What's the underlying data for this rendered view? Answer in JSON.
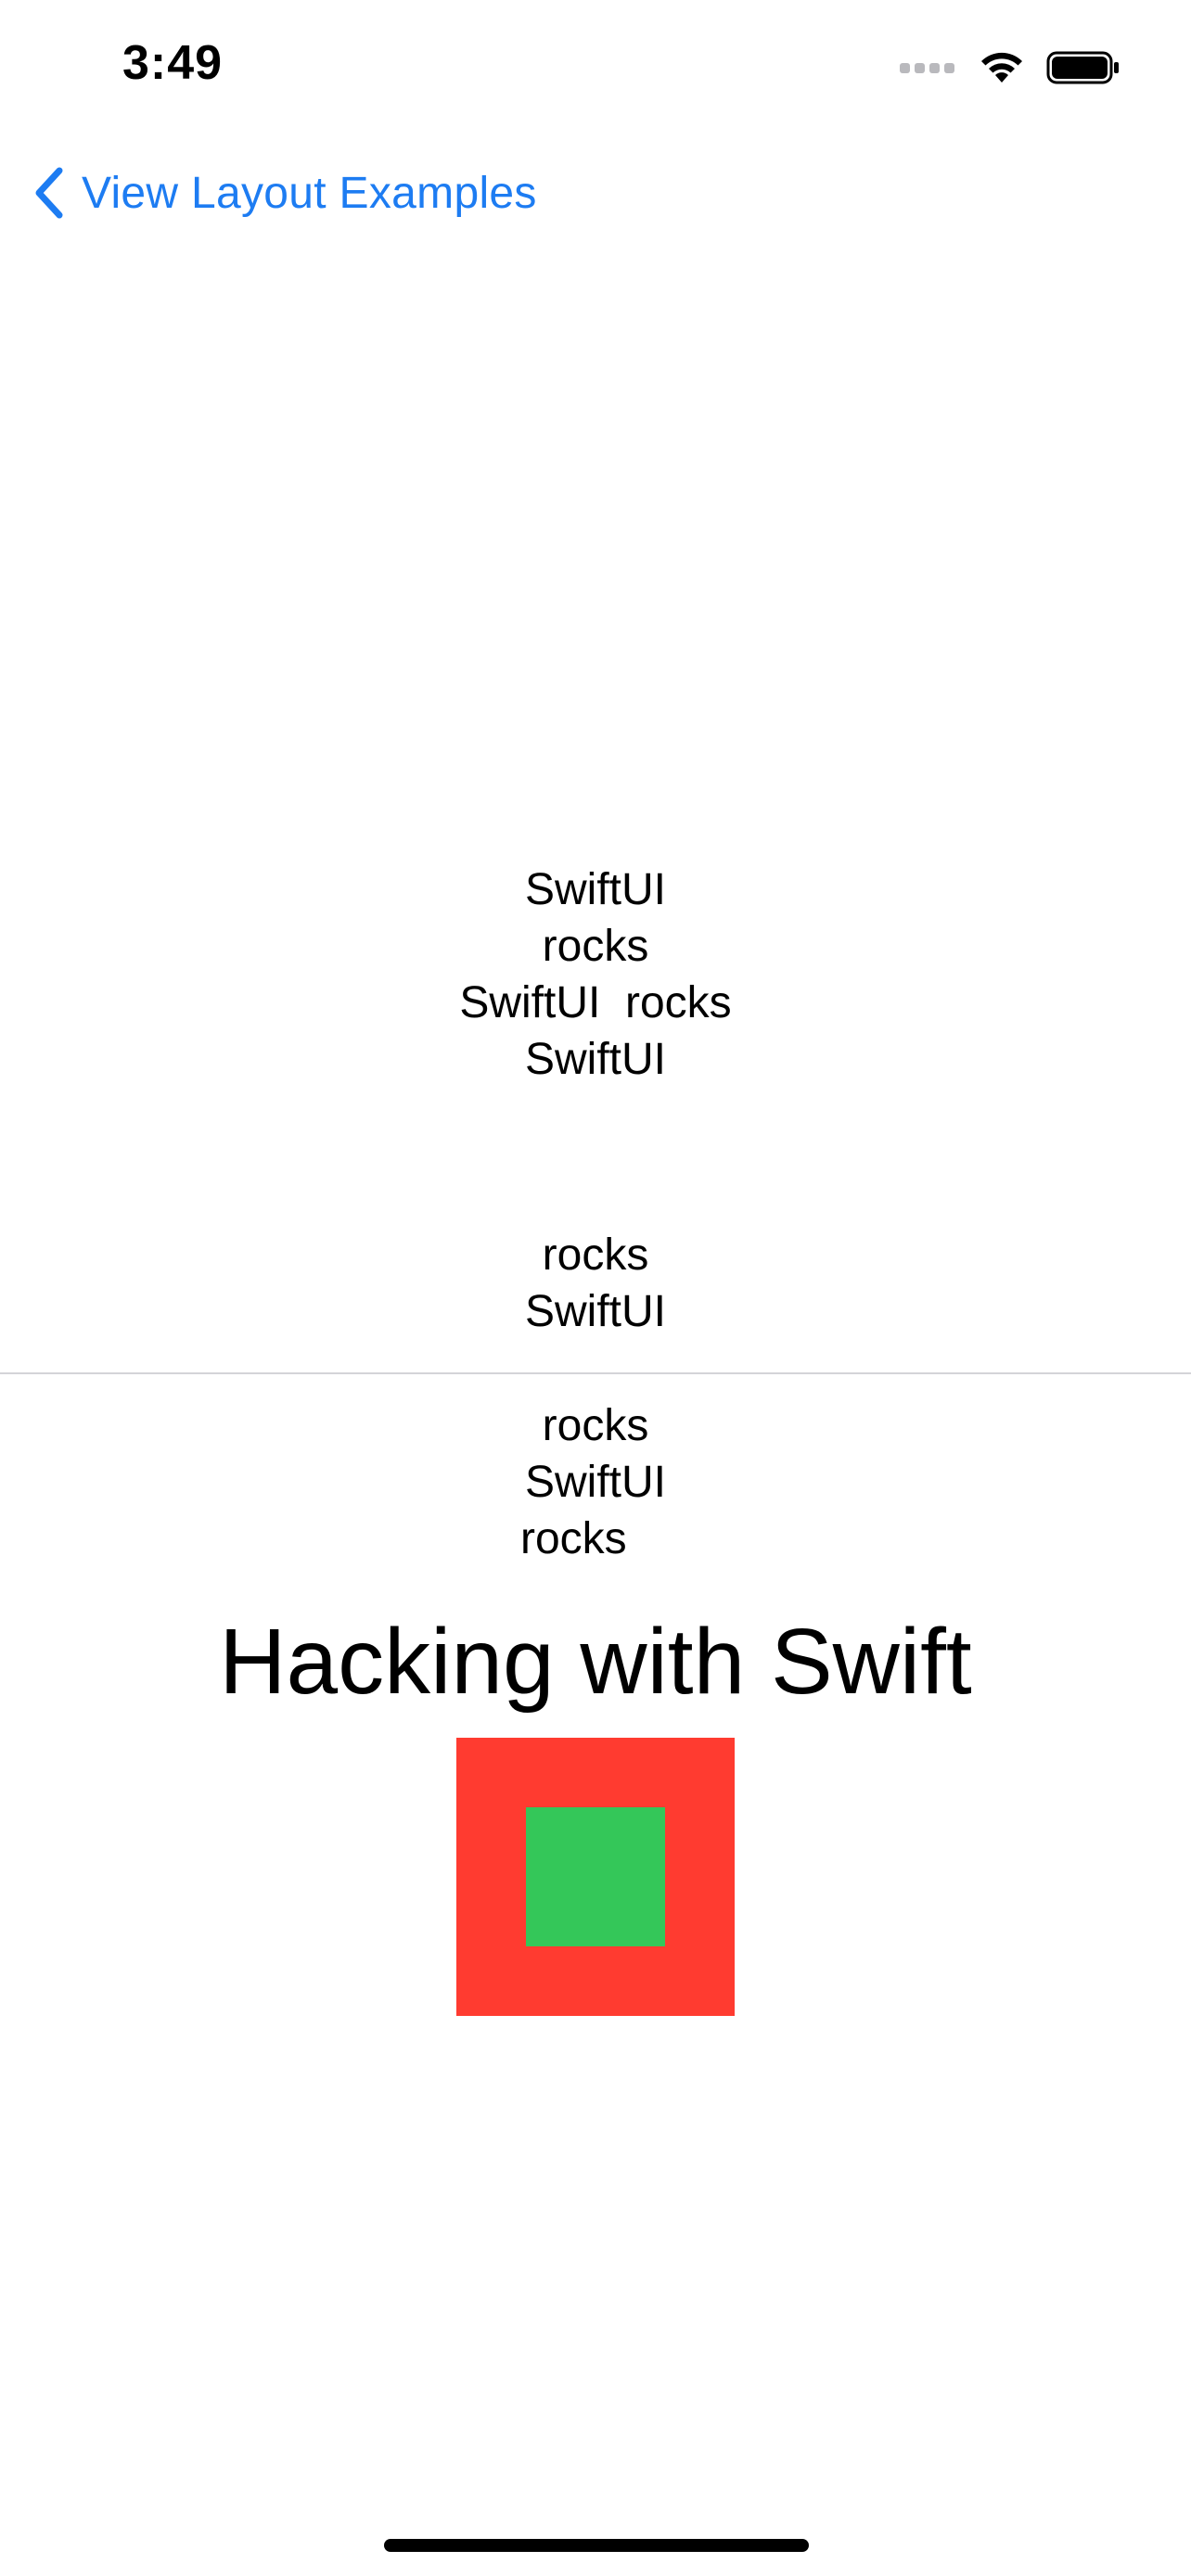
{
  "status_bar": {
    "time": "3:49",
    "icons": [
      "cellular-signal-icon",
      "wifi-icon",
      "battery-icon"
    ]
  },
  "nav": {
    "back_label": "View Layout Examples",
    "back_icon": "chevron-left-icon"
  },
  "content": {
    "lines_group_1": [
      "SwiftUI",
      "rocks",
      "SwiftUI  rocks",
      "SwiftUI"
    ],
    "lines_group_2": [
      "rocks",
      "SwiftUI"
    ],
    "lines_group_3": [
      "rocks",
      "SwiftUI",
      "rocks"
    ],
    "headline": "Hacking with Swift"
  },
  "colors": {
    "accent": "#1d7cf2",
    "outer_square": "#ff3b30",
    "inner_square": "#34c759"
  }
}
